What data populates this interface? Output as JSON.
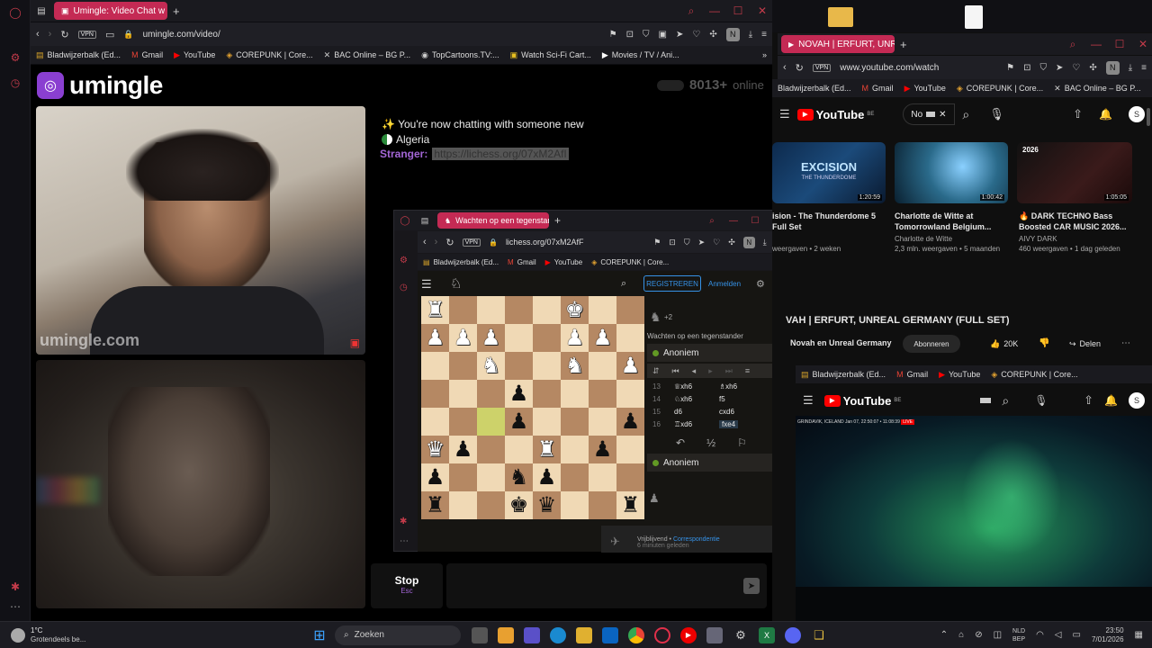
{
  "left_window": {
    "tab_title": "Umingle: Video Chat w",
    "url": "umingle.com/video/",
    "bookmarks": [
      "Bladwijzerbalk (Ed...",
      "Gmail",
      "YouTube",
      "COREPUNK | Core...",
      "BAC Online – BG P...",
      "TopCartoons.TV:...",
      "Watch Sci-Fi Cart...",
      "Movies / TV / Ani..."
    ],
    "vpn": "VPN",
    "profile": "N"
  },
  "umingle": {
    "logo": "umingle",
    "online_count": "8013+",
    "online_label": "online",
    "watermark": "umingle.com",
    "chat_new": "You're now chatting with someone new",
    "country": "Algeria",
    "stranger_label": "Stranger:",
    "stranger_msg": "https://lichess.org/07xM2AfI",
    "stop_label": "Stop",
    "stop_key": "Esc"
  },
  "chess_window": {
    "tab_title": "Wachten op een tegenstan",
    "url": "lichess.org/07xM2AfF",
    "bookmarks": [
      "Bladwijzerbalk (Ed...",
      "Gmail",
      "YouTube",
      "COREPUNK | Core..."
    ],
    "register": "REGISTREREN",
    "login": "Anmelden",
    "material": "+2",
    "waiting": "Wachten op een tegenstander",
    "player_top": "Anoniem",
    "player_bottom": "Anoniem",
    "moves": [
      {
        "n": "13",
        "w": "♕xh6",
        "b": "♗xh6"
      },
      {
        "n": "14",
        "w": "♘xh6",
        "b": "f5"
      },
      {
        "n": "15",
        "w": "d6",
        "b": "cxd6"
      },
      {
        "n": "16",
        "w": "♖xd6",
        "b": "fxe4"
      }
    ],
    "draw_symbol": "½",
    "footer_text": "Vrijblijvend",
    "footer_link": "Correspondentie",
    "footer_sub": "6 minuten geleden",
    "pieces": [
      {
        "sq": "a8",
        "p": "♜",
        "c": "w"
      },
      {
        "sq": "f8",
        "p": "♚",
        "c": "w"
      },
      {
        "sq": "a7",
        "p": "♟",
        "c": "w"
      },
      {
        "sq": "b7",
        "p": "♟",
        "c": "w"
      },
      {
        "sq": "c7",
        "p": "♟",
        "c": "w"
      },
      {
        "sq": "f7",
        "p": "♟",
        "c": "w"
      },
      {
        "sq": "g7",
        "p": "♟",
        "c": "w"
      },
      {
        "sq": "c6",
        "p": "♞",
        "c": "w"
      },
      {
        "sq": "f6",
        "p": "♞",
        "c": "w"
      },
      {
        "sq": "h6",
        "p": "♟",
        "c": "w"
      },
      {
        "sq": "d5",
        "p": "♟",
        "c": "b"
      },
      {
        "sq": "d4",
        "p": "♟",
        "c": "b"
      },
      {
        "sq": "h4",
        "p": "♟",
        "c": "b"
      },
      {
        "sq": "a3",
        "p": "♛",
        "c": "w"
      },
      {
        "sq": "b3",
        "p": "♟",
        "c": "b"
      },
      {
        "sq": "e3",
        "p": "♜",
        "c": "w"
      },
      {
        "sq": "g3",
        "p": "♟",
        "c": "b"
      },
      {
        "sq": "a2",
        "p": "♟",
        "c": "b"
      },
      {
        "sq": "d2",
        "p": "♞",
        "c": "b"
      },
      {
        "sq": "e2",
        "p": "♟",
        "c": "b"
      },
      {
        "sq": "a1",
        "p": "♜",
        "c": "b"
      },
      {
        "sq": "d1",
        "p": "♚",
        "c": "b"
      },
      {
        "sq": "e1",
        "p": "♛",
        "c": "b"
      },
      {
        "sq": "h1",
        "p": "♜",
        "c": "b"
      }
    ],
    "highlight": "c4"
  },
  "right_window": {
    "tab_title": "NOVAH | ERFURT, UNREAL",
    "url": "www.youtube.com/watch",
    "bookmarks": [
      "Bladwijzerbalk (Ed...",
      "Gmail",
      "YouTube",
      "COREPUNK | Core...",
      "BAC Online – BG P..."
    ],
    "yt_logo": "YouTube",
    "yt_region": "BE",
    "search_value": "No",
    "avatar": "S",
    "videos": [
      {
        "title": "ision - The Thunderdome 5 Full Set",
        "channel": "",
        "meta": "weergaven • 2 weken",
        "duration": "1:20:59",
        "color": "#1b4a7a"
      },
      {
        "title": "Charlotte de Witte at Tomorrowland Belgium...",
        "channel": "Charlotte de Witte",
        "meta": "2,3 mln. weergaven • 5 maanden",
        "duration": "1:00:42",
        "color": "#2a6a8a"
      },
      {
        "title": "DARK TECHNO Bass Boosted CAR MUSIC 2026...",
        "channel": "AIVY DARK",
        "meta": "460 weergaven • 1 dag geleden",
        "duration": "1:05:05",
        "color": "#3a1a1a"
      }
    ],
    "thumb_text": "EXCISION",
    "thumb_sub": "THE THUNDERDOME",
    "thumb_badge": "2026",
    "video_title": "VAH | ERFURT, UNREAL GERMANY (FULL SET)",
    "channel_name": "Novah en Unreal Germany",
    "subscribe": "Abonneren",
    "likes": "20K",
    "share": "Delen",
    "live_text": "GRINDAVIK, ICELAND  Jan 07, 22:50:07  •  11:08:39",
    "live_badge": "LIVE"
  },
  "taskbar": {
    "weather_temp": "1°C",
    "weather_desc": "Grotendeels be...",
    "search_placeholder": "Zoeken",
    "lang": "NLD",
    "lang_sub": "BEP",
    "time": "23:50",
    "date": "7/01/2026"
  },
  "colors": {
    "accent": "#c42a54",
    "light_square": "#f0d9b5",
    "dark_square": "#b58863",
    "highlight": "#cdd26a"
  }
}
